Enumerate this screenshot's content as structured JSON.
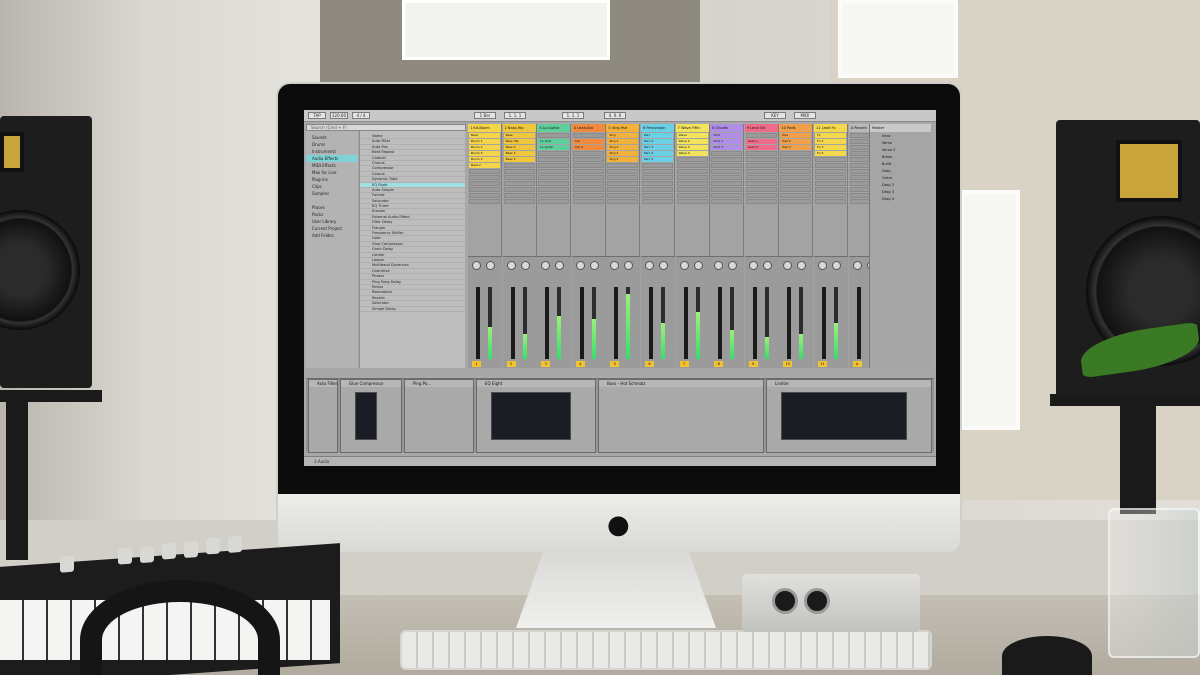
{
  "scene": {
    "description_colors": {
      "wall": "#e4e2dd",
      "desk": "#b1ab9f",
      "imac_body": "#e6e6e4",
      "screen_bg": "#a8a8a8",
      "accent_cyan": "#7fd2d8",
      "meter_green": "#35e06a",
      "fader_yellow": "#f2c230"
    }
  },
  "daw": {
    "transport": [
      "TAP",
      "120.00",
      "4 / 4",
      "1 Bar",
      "1. 1. 1",
      "1. 1. 1",
      "4. 0. 0",
      "KEY",
      "MIDI"
    ],
    "search_placeholder": "Search (Cmd + F)",
    "browser_categories": [
      "Sounds",
      "Drums",
      "Instruments",
      "Audio Effects",
      "MIDI Effects",
      "Max for Live",
      "Plug-ins",
      "Clips",
      "Samples",
      "",
      "Places",
      "Packs",
      "User Library",
      "Current Project",
      "Add Folder..."
    ],
    "browser_selected_index": 3,
    "files": [
      "Name",
      "Auto Filter",
      "Auto Pan",
      "Beat Repeat",
      "Cabinet",
      "Chorus",
      "Compressor",
      "Corpus",
      "Dynamic Tube",
      "EQ Eight",
      "Auto Simple",
      "Format",
      "Saturator",
      "EQ Three",
      "Erosion",
      "External Audio Effect",
      "Filter Delay",
      "Flanger",
      "Frequency Shifter",
      "Gate",
      "Glue Compressor",
      "Grain Delay",
      "Limiter",
      "Looper",
      "Multiband Dynamics",
      "Overdrive",
      "Phaser",
      "Ping Pong Delay",
      "Redux",
      "Resonators",
      "Reverb",
      "Saturator",
      "Simple Delay"
    ],
    "files_selected_index": 9,
    "tracks": [
      {
        "name": "1 Kit-Boom",
        "color": "#f5d44a",
        "clips": [
          "Beat",
          "Boom 1",
          "Boom 2",
          "Boom 3",
          "Boom 4",
          "Beat 2"
        ],
        "level": 0.45,
        "fader_num": "1"
      },
      {
        "name": "2 Bass-Hip",
        "color": "#f0c63a",
        "clips": [
          "Bass",
          "Bass Hip",
          "Bass 2",
          "Bass 3",
          "Bass 4"
        ],
        "level": 0.35,
        "fader_num": "2"
      },
      {
        "name": "3 Lo-Guitar",
        "color": "#5ecf9a",
        "clips": [
          "",
          "Lo Guit",
          "Lo Guit2",
          "",
          ""
        ],
        "level": 0.6,
        "fader_num": "3"
      },
      {
        "name": "4 Lead-Arp",
        "color": "#f28a3e",
        "clips": [
          "",
          "Arp",
          "Arp 2",
          "",
          ""
        ],
        "level": 0.55,
        "fader_num": "4"
      },
      {
        "name": "5 Strg-Pad",
        "color": "#f5b23a",
        "clips": [
          "Strg",
          "Strg 2",
          "Strg 3",
          "Strg 4",
          "Strg 5"
        ],
        "level": 0.9,
        "fader_num": "5"
      },
      {
        "name": "6 Percussion",
        "color": "#6ad0e6",
        "clips": [
          "Perc",
          "Perc 2",
          "Perc 3",
          "Perc 4",
          "Perc 5"
        ],
        "level": 0.5,
        "fader_num": "6"
      },
      {
        "name": "7 Wave Fifth",
        "color": "#f2e35a",
        "clips": [
          "Wave",
          "Wave 2",
          "Wave 3",
          "Wave 4"
        ],
        "level": 0.65,
        "fader_num": "7"
      },
      {
        "name": "8 Chords",
        "color": "#b08de6",
        "clips": [
          "Chrd",
          "Chrd 2",
          "Chrd 3"
        ],
        "level": 0.4,
        "fader_num": "8"
      },
      {
        "name": "9 Lead Gtr",
        "color": "#f06a8a",
        "clips": [
          "",
          "Lead 1",
          "Lead 2"
        ],
        "level": 0.3,
        "fader_num": "9"
      },
      {
        "name": "10 Pads",
        "color": "#f0a04a",
        "clips": [
          "Pad",
          "Pad 2",
          "Pad 3"
        ],
        "level": 0.35,
        "fader_num": "10"
      },
      {
        "name": "11 Lead Fx",
        "color": "#f2d84a",
        "clips": [
          "Fx",
          "Fx 2",
          "Fx 3",
          "Fx 4"
        ],
        "level": 0.5,
        "fader_num": "11"
      },
      {
        "name": "A Reverb",
        "color": "#b9b9b9",
        "clips": [],
        "level": 0.0,
        "fader_num": "A"
      }
    ],
    "master_title": "Master",
    "scenes": [
      "Intro",
      "Verse",
      "Verse 2",
      "Break",
      "Build",
      "Drop",
      "Outro",
      "Drop 2",
      "Drop 3",
      "Drop 4"
    ],
    "devices": [
      {
        "title": "Auto Filter"
      },
      {
        "title": "Glue Compressor"
      },
      {
        "title": "Ping Po..."
      },
      {
        "title": "EQ Eight"
      },
      {
        "title": "Bass - Hot Schmalz"
      },
      {
        "title": "Limiter"
      }
    ],
    "status_text": "1-Audio"
  }
}
